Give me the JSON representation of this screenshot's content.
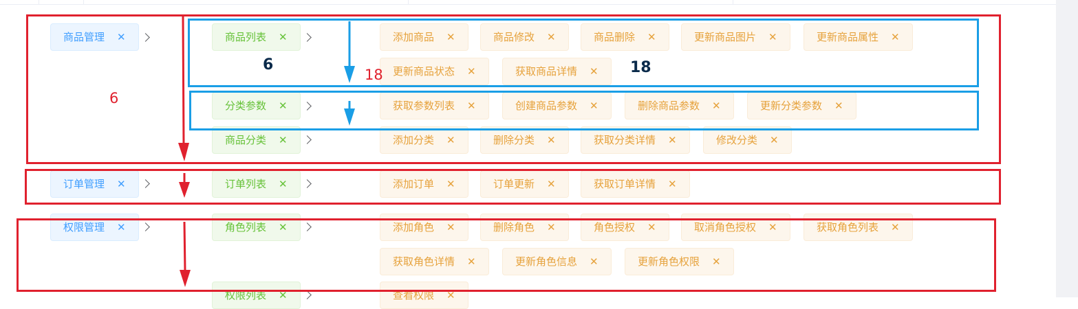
{
  "level1": [
    "商品管理",
    "订单管理",
    "权限管理"
  ],
  "level2": [
    "商品列表",
    "分类参数",
    "商品分类",
    "订单列表",
    "角色列表",
    "权限列表"
  ],
  "level3": {
    "goods_list": [
      "添加商品",
      "商品修改",
      "商品删除",
      "更新商品图片",
      "更新商品属性",
      "更新商品状态",
      "获取商品详情"
    ],
    "params": [
      "获取参数列表",
      "创建商品参数",
      "删除商品参数",
      "更新分类参数"
    ],
    "categories": [
      "添加分类",
      "删除分类",
      "获取分类详情",
      "修改分类"
    ],
    "orders": [
      "添加订单",
      "订单更新",
      "获取订单详情"
    ],
    "roles": [
      "添加角色",
      "删除角色",
      "角色授权",
      "取消角色授权",
      "获取角色列表",
      "获取角色详情",
      "更新角色信息",
      "更新角色权限"
    ],
    "rights": [
      "查看权限"
    ]
  },
  "close_glyph": "✕",
  "annotations": {
    "count_l1_left": "6",
    "count_l2": "6",
    "count_l3_red": "18",
    "count_l3_dark": "18"
  },
  "colors": {
    "annotation_red": "#e0212e",
    "annotation_blue": "#1a9ee6",
    "tag_l1": "#409eff",
    "tag_l2": "#67c23a",
    "tag_l3": "#e6a23c"
  }
}
